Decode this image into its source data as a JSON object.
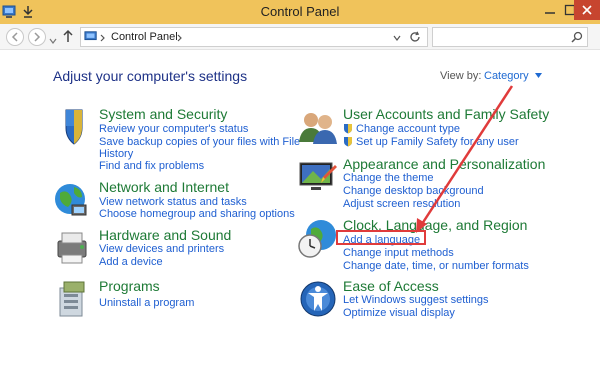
{
  "window": {
    "title": "Control Panel"
  },
  "address": {
    "path": "Control Panel",
    "search_placeholder": ""
  },
  "main": {
    "heading": "Adjust your computer's settings",
    "view_by_label": "View by:",
    "view_by_value": "Category"
  },
  "categories": {
    "system": {
      "title": "System and Security",
      "links": [
        "Review your computer's status",
        "Save backup copies of your files with File",
        "History",
        "Find and fix problems"
      ]
    },
    "network": {
      "title": "Network and Internet",
      "links": [
        "View network status and tasks",
        "Choose homegroup and sharing options"
      ]
    },
    "hardware": {
      "title": "Hardware and Sound",
      "links": [
        "View devices and printers",
        "Add a device"
      ]
    },
    "programs": {
      "title": "Programs",
      "links": [
        "Uninstall a program"
      ]
    },
    "accounts": {
      "title": "User Accounts and Family Safety",
      "links": [
        "Change account type",
        "Set up Family Safety for any user"
      ]
    },
    "appearance": {
      "title": "Appearance and Personalization",
      "links": [
        "Change the theme",
        "Change desktop background",
        "Adjust screen resolution"
      ]
    },
    "clock": {
      "title": "Clock, Language, and Region",
      "links": [
        "Add a language",
        "Change input methods",
        "Change date, time, or number formats"
      ]
    },
    "ease": {
      "title": "Ease of Access",
      "links": [
        "Let Windows suggest settings",
        "Optimize visual display"
      ]
    }
  },
  "colors": {
    "titlebar": "#f0c35b",
    "category_title": "#1e7a36",
    "link": "#1f5fd1",
    "heading": "#1e3287",
    "annotation": "#e03b3b"
  }
}
